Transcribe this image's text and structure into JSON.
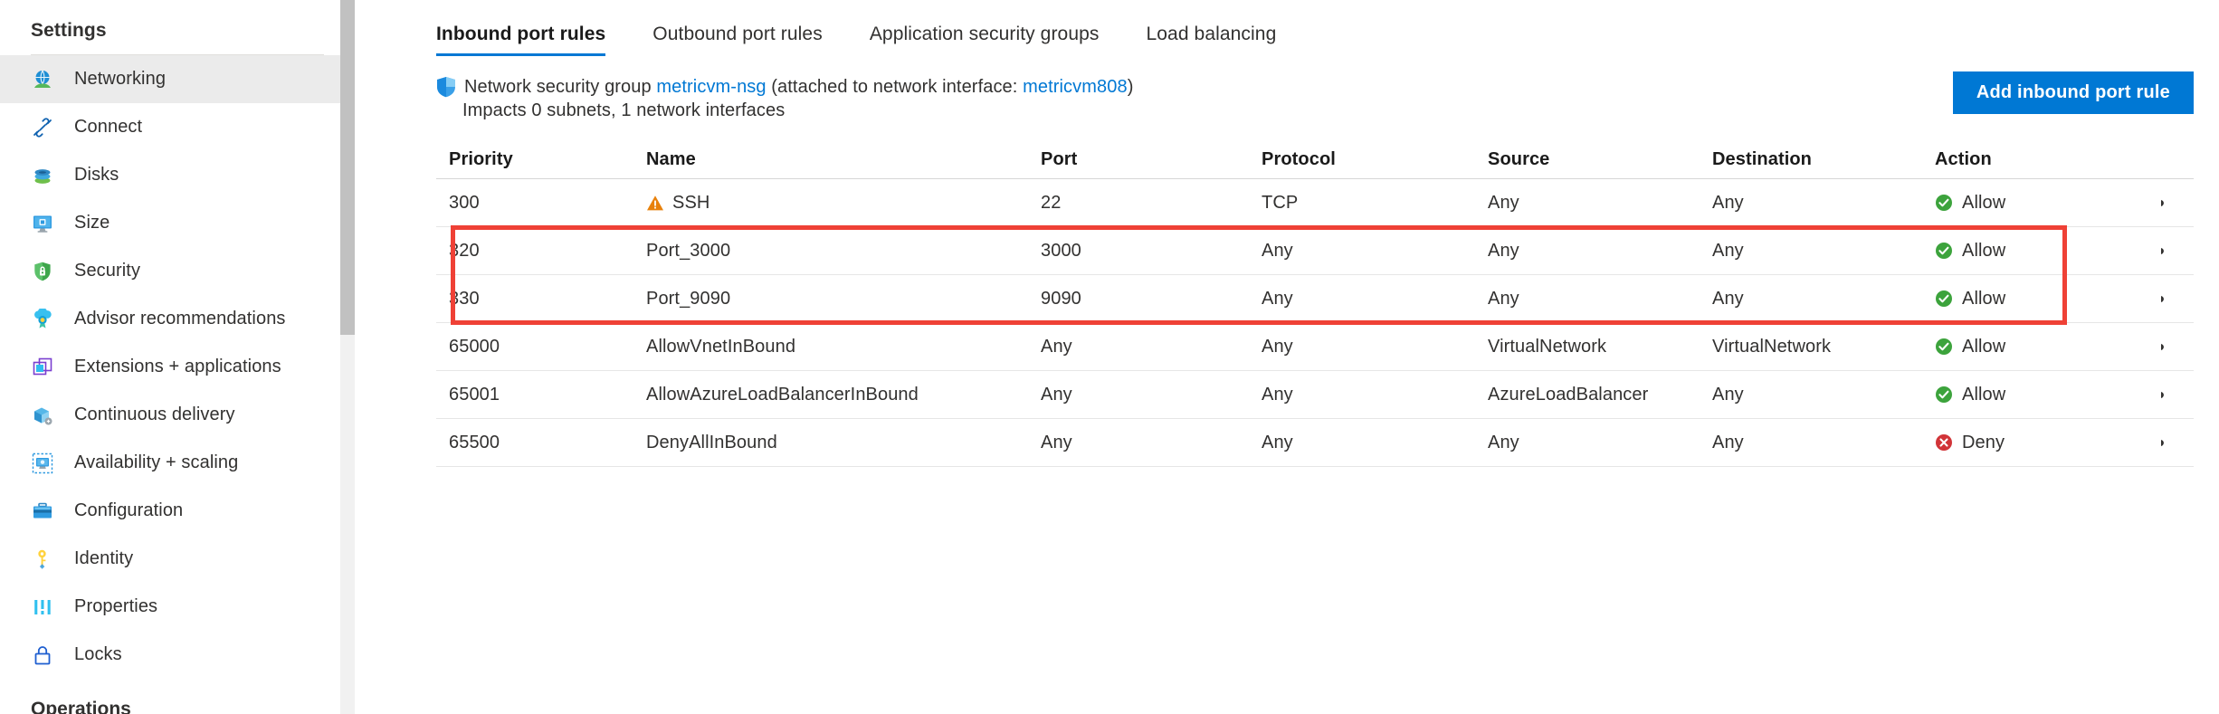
{
  "sidebar": {
    "title": "Settings",
    "group_heading": "Operations",
    "items": [
      {
        "label": "Networking",
        "icon": "networking-icon",
        "selected": true
      },
      {
        "label": "Connect",
        "icon": "connect-icon",
        "selected": false
      },
      {
        "label": "Disks",
        "icon": "disks-icon",
        "selected": false
      },
      {
        "label": "Size",
        "icon": "size-icon",
        "selected": false
      },
      {
        "label": "Security",
        "icon": "security-shield-icon",
        "selected": false
      },
      {
        "label": "Advisor recommendations",
        "icon": "advisor-icon",
        "selected": false
      },
      {
        "label": "Extensions + applications",
        "icon": "extensions-icon",
        "selected": false
      },
      {
        "label": "Continuous delivery",
        "icon": "continuous-delivery-icon",
        "selected": false
      },
      {
        "label": "Availability + scaling",
        "icon": "availability-scaling-icon",
        "selected": false
      },
      {
        "label": "Configuration",
        "icon": "configuration-icon",
        "selected": false
      },
      {
        "label": "Identity",
        "icon": "identity-key-icon",
        "selected": false
      },
      {
        "label": "Properties",
        "icon": "properties-icon",
        "selected": false
      },
      {
        "label": "Locks",
        "icon": "locks-padlock-icon",
        "selected": false
      }
    ]
  },
  "main": {
    "tabs": [
      {
        "label": "Inbound port rules",
        "active": true
      },
      {
        "label": "Outbound port rules",
        "active": false
      },
      {
        "label": "Application security groups",
        "active": false
      },
      {
        "label": "Load balancing",
        "active": false
      }
    ],
    "nsg": {
      "prefix": "Network security group",
      "name": "metricvm-nsg",
      "attached_prefix": "(attached to network interface:",
      "interface": "metricvm808",
      "attached_suffix": ")",
      "impacts": "Impacts 0 subnets, 1 network interfaces",
      "shield_icon": "shield-icon"
    },
    "add_rule_label": "Add inbound port rule",
    "table": {
      "columns": [
        "Priority",
        "Name",
        "Port",
        "Protocol",
        "Source",
        "Destination",
        "Action"
      ],
      "rows": [
        {
          "priority": "300",
          "name": "SSH",
          "port": "22",
          "protocol": "TCP",
          "source": "Any",
          "destination": "Any",
          "action": "Allow",
          "action_state": "allow",
          "warning": true,
          "highlighted": false
        },
        {
          "priority": "320",
          "name": "Port_3000",
          "port": "3000",
          "protocol": "Any",
          "source": "Any",
          "destination": "Any",
          "action": "Allow",
          "action_state": "allow",
          "warning": false,
          "highlighted": true
        },
        {
          "priority": "330",
          "name": "Port_9090",
          "port": "9090",
          "protocol": "Any",
          "source": "Any",
          "destination": "Any",
          "action": "Allow",
          "action_state": "allow",
          "warning": false,
          "highlighted": true
        },
        {
          "priority": "65000",
          "name": "AllowVnetInBound",
          "port": "Any",
          "protocol": "Any",
          "source": "VirtualNetwork",
          "destination": "VirtualNetwork",
          "action": "Allow",
          "action_state": "allow",
          "warning": false,
          "highlighted": false
        },
        {
          "priority": "65001",
          "name": "AllowAzureLoadBalancerInBound",
          "port": "Any",
          "protocol": "Any",
          "source": "AzureLoadBalancer",
          "destination": "Any",
          "action": "Allow",
          "action_state": "allow",
          "warning": false,
          "highlighted": false
        },
        {
          "priority": "65500",
          "name": "DenyAllInBound",
          "port": "Any",
          "protocol": "Any",
          "source": "Any",
          "destination": "Any",
          "action": "Deny",
          "action_state": "deny",
          "warning": false,
          "highlighted": false
        }
      ],
      "row_menu_label": "•••"
    }
  },
  "colors": {
    "accent": "#0078d4",
    "allow": "#3ca33c",
    "deny": "#d13438",
    "warning": "#e8810c",
    "highlight": "#ef4136",
    "selected_nav": "#ebebeb"
  }
}
